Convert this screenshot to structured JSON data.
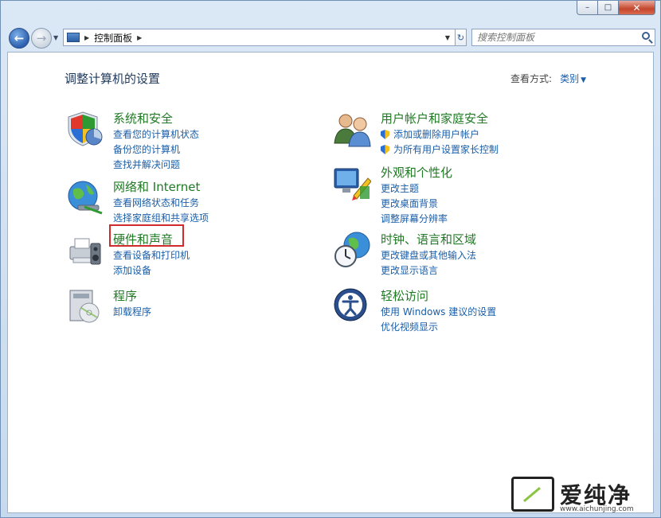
{
  "window": {
    "caption": {
      "min": "–",
      "max": "□",
      "close": "✕"
    }
  },
  "nav": {
    "back_glyph": "←",
    "forward_glyph": "→",
    "history_glyph": "▼",
    "breadcrumb_sep": "▶",
    "address": "控制面板",
    "address_sep_after": "▶",
    "address_dropdown": "▼",
    "refresh_glyph": "↻",
    "search_placeholder": "搜索控制面板"
  },
  "content": {
    "title": "调整计算机的设置",
    "view_by_label": "查看方式:",
    "view_by_value": "类别",
    "view_by_arrow": "▼",
    "categories": [
      {
        "id": "system-security",
        "title": "系统和安全",
        "icon": "shield-pie-icon",
        "links": [
          "查看您的计算机状态",
          "备份您的计算机",
          "查找并解决问题"
        ]
      },
      {
        "id": "network-internet",
        "title": "网络和 Internet",
        "icon": "globe-network-icon",
        "links": [
          "查看网络状态和任务",
          "选择家庭组和共享选项"
        ]
      },
      {
        "id": "hardware-sound",
        "title": "硬件和声音",
        "icon": "printer-speaker-icon",
        "links": [
          "查看设备和打印机",
          "添加设备"
        ]
      },
      {
        "id": "programs",
        "title": "程序",
        "icon": "programs-disc-icon",
        "links": [
          "卸载程序"
        ]
      },
      {
        "id": "user-accounts",
        "title": "用户帐户和家庭安全",
        "icon": "users-icon",
        "links": [
          "添加或删除用户帐户",
          "为所有用户设置家长控制"
        ]
      },
      {
        "id": "appearance",
        "title": "外观和个性化",
        "icon": "monitor-palette-icon",
        "links": [
          "更改主题",
          "更改桌面背景",
          "调整屏幕分辨率"
        ]
      },
      {
        "id": "clock-region",
        "title": "时钟、语言和区域",
        "icon": "clock-globe-icon",
        "links": [
          "更改键盘或其他输入法",
          "更改显示语言"
        ]
      },
      {
        "id": "ease-access",
        "title": "轻松访问",
        "icon": "ease-access-icon",
        "links": [
          "使用 Windows 建议的设置",
          "优化视频显示"
        ]
      }
    ]
  },
  "watermark": {
    "text": "爱纯净",
    "url": "www.aichunjing.com"
  },
  "colors": {
    "category_title": "#1f7a23",
    "link": "#1a5ea8",
    "highlight": "#d12a2a"
  }
}
